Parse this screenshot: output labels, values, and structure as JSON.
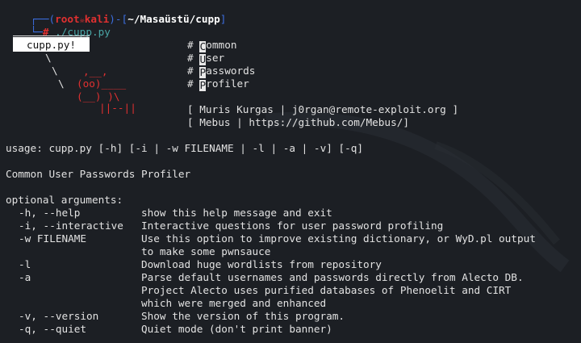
{
  "prompt": {
    "bracket_open": "┌──(",
    "user": "root",
    "skull_icon": "💀",
    "host": "kali",
    "bracket_mid": ")-[",
    "path": "~/Masaüstü/cupp",
    "bracket_close": "]",
    "corner": "└─",
    "hash": "#",
    "command": "./cupp.py"
  },
  "banner": {
    "label": "cupp.py!",
    "menu": [
      {
        "hash": "#",
        "letter": "C",
        "rest": "ommon"
      },
      {
        "hash": "#",
        "letter": "U",
        "rest": "ser"
      },
      {
        "hash": "#",
        "letter": "P",
        "rest": "asswords"
      },
      {
        "hash": "#",
        "letter": "P",
        "rest": "rofiler"
      }
    ],
    "ascii_lines": [
      "\\",
      " \\",
      "  \\"
    ],
    "credits": [
      "[ Muris Kurgas | j0rgan@remote-exploit.org ]",
      "[ Mebus | https://github.com/Mebus/]"
    ]
  },
  "usage": "usage: cupp.py [-h] [-i | -w FILENAME | -l | -a | -v] [-q]",
  "description": "Common User Passwords Profiler",
  "optional_header": "optional arguments:",
  "options": [
    {
      "flag": "-h, --help",
      "desc": [
        "show this help message and exit"
      ]
    },
    {
      "flag": "-i, --interactive",
      "desc": [
        "Interactive questions for user password profiling"
      ]
    },
    {
      "flag": "-w FILENAME",
      "desc": [
        "Use this option to improve existing dictionary, or WyD.pl output",
        "to make some pwnsauce"
      ]
    },
    {
      "flag": "-l",
      "desc": [
        "Download huge wordlists from repository"
      ]
    },
    {
      "flag": "-a",
      "desc": [
        "Parse default usernames and passwords directly from Alecto DB.",
        "Project Alecto uses purified databases of Phenoelit and CIRT",
        "which were merged and enhanced"
      ]
    },
    {
      "flag": "-v, --version",
      "desc": [
        "Show the version of this program."
      ]
    },
    {
      "flag": "-q, --quiet",
      "desc": [
        "Quiet mode (don't print banner)"
      ]
    }
  ],
  "colors": {
    "background": "#1c1f24",
    "prompt_blue": "#3c6ee0",
    "prompt_red": "#e03030",
    "command_teal": "#4aa6a6",
    "text": "#e2e2e2"
  }
}
